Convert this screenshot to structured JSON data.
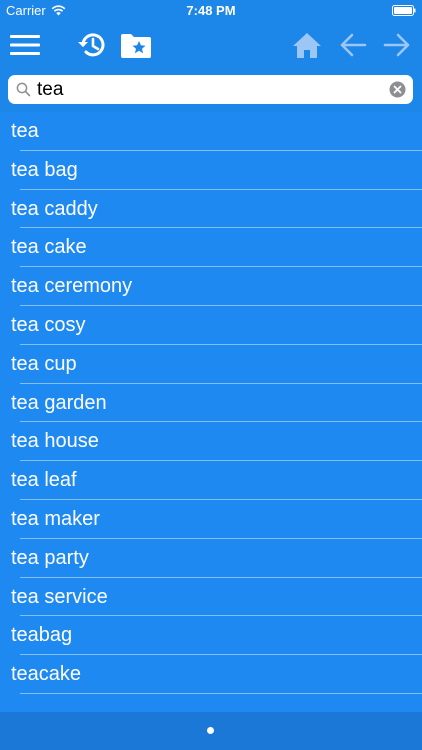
{
  "status_bar": {
    "carrier": "Carrier",
    "time": "7:48 PM",
    "icons": [
      "wifi-icon",
      "battery-icon"
    ]
  },
  "toolbar": {
    "icons": [
      "menu-icon",
      "history-icon",
      "favorites-folder-icon",
      "home-icon",
      "back-arrow-icon",
      "forward-arrow-icon"
    ],
    "disabled_color": "#9cc6f5"
  },
  "search": {
    "value": "tea",
    "icons": [
      "search-icon",
      "clear-icon"
    ]
  },
  "results": [
    "tea",
    "tea bag",
    "tea caddy",
    "tea cake",
    "tea ceremony",
    "tea cosy",
    "tea cup",
    "tea garden",
    "tea house",
    "tea leaf",
    "tea maker",
    "tea party",
    "tea service",
    "teabag",
    "teacake"
  ],
  "colors": {
    "background": "#1e8af1",
    "bars": "#1d86e9",
    "bottom_bar": "#1b78d6"
  }
}
